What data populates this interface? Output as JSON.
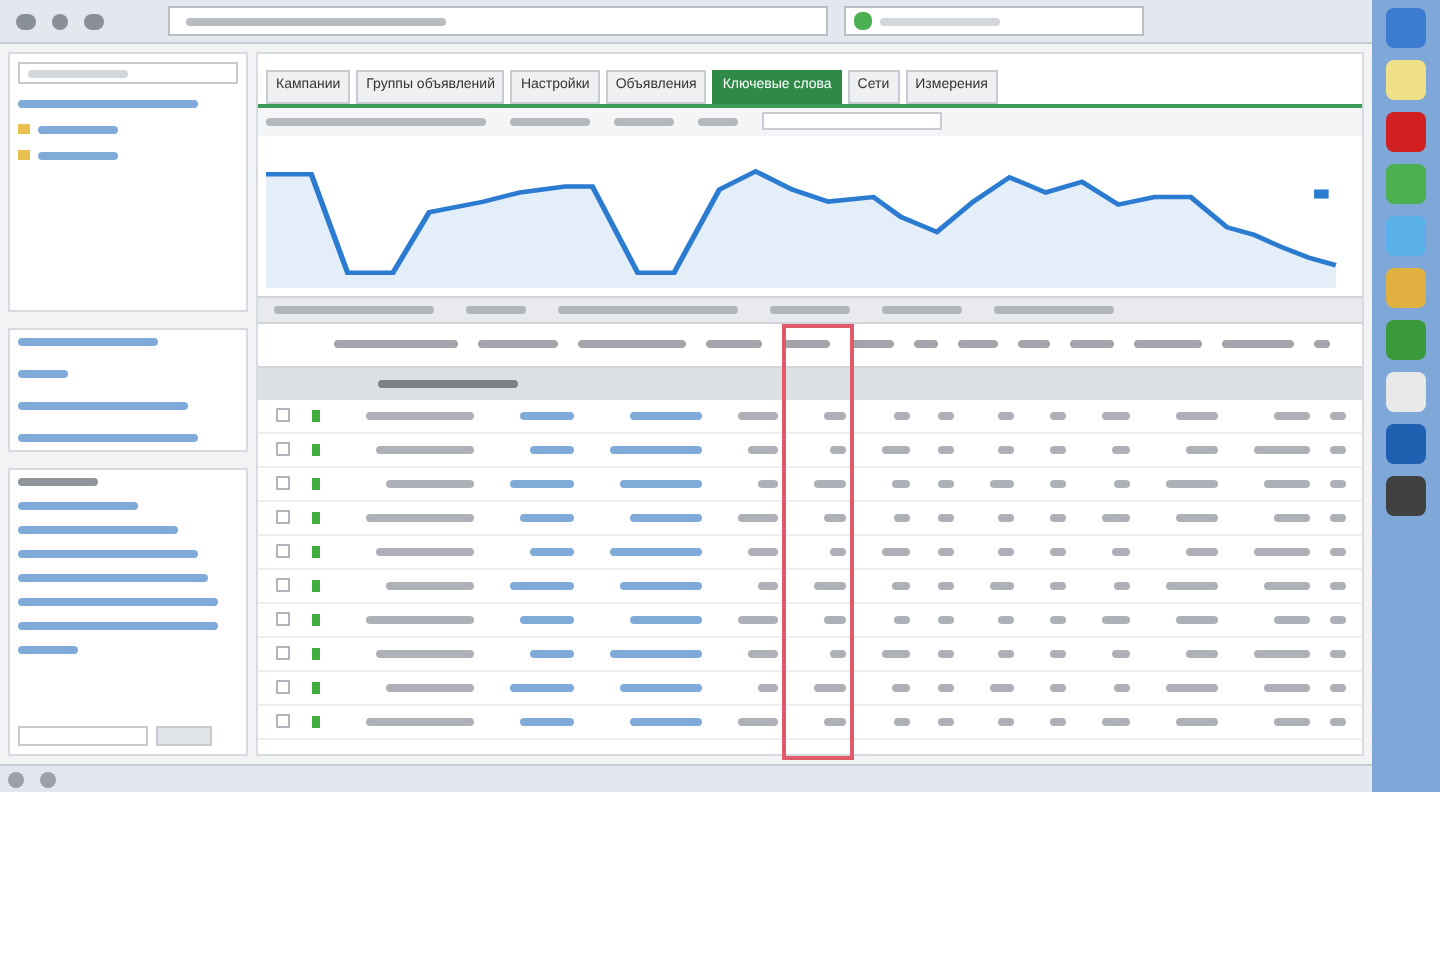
{
  "tabs": [
    {
      "label": "Кампании",
      "selected": false
    },
    {
      "label": "Группы объявлений",
      "selected": false
    },
    {
      "label": "Настройки",
      "selected": false
    },
    {
      "label": "Объявления",
      "selected": false
    },
    {
      "label": "Ключевые слова",
      "selected": true
    },
    {
      "label": "Сети",
      "selected": false
    },
    {
      "label": "Измерения",
      "selected": false
    }
  ],
  "table": {
    "rows": [
      {
        "checked": false,
        "enabled": true
      },
      {
        "checked": false,
        "enabled": true
      },
      {
        "checked": false,
        "enabled": true
      },
      {
        "checked": false,
        "enabled": true
      },
      {
        "checked": false,
        "enabled": true
      },
      {
        "checked": false,
        "enabled": true
      },
      {
        "checked": false,
        "enabled": true
      },
      {
        "checked": false,
        "enabled": true
      },
      {
        "checked": false,
        "enabled": true
      },
      {
        "checked": false,
        "enabled": true
      }
    ]
  }
}
